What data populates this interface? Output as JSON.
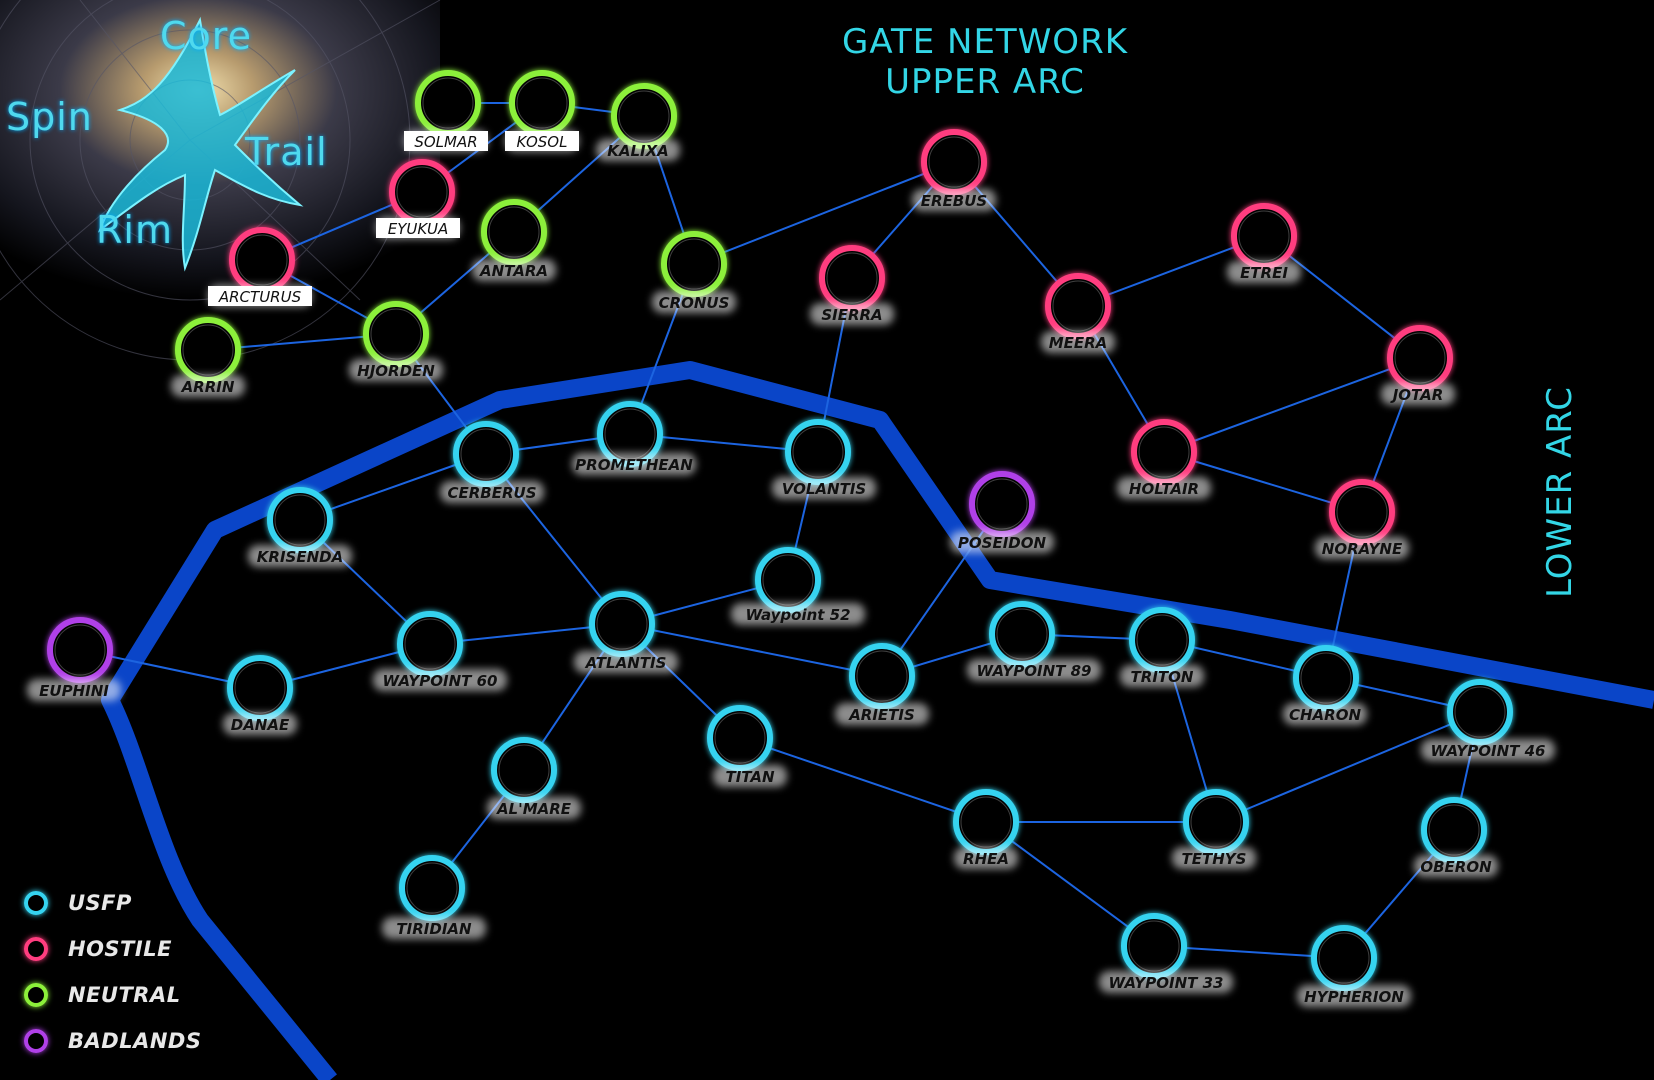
{
  "titles": {
    "upper": "GATE NETWORK\nUPPER ARC",
    "lower": "LOWER ARC"
  },
  "logo": {
    "core": "Core",
    "spin": "Spin",
    "trail": "Trail",
    "rim": "Rim"
  },
  "colors": {
    "USFP": "#35d3f0",
    "HOSTILE": "#ff3d7f",
    "NEUTRAL": "#8cf03a",
    "BADLANDS": "#b040e8",
    "link": "#1c64e0",
    "border": "#0a45c8"
  },
  "legend": [
    {
      "label": "USFP",
      "faction": "USFP"
    },
    {
      "label": "HOSTILE",
      "faction": "HOSTILE"
    },
    {
      "label": "NEUTRAL",
      "faction": "NEUTRAL"
    },
    {
      "label": "BADLANDS",
      "faction": "BADLANDS"
    }
  ],
  "systems": [
    {
      "id": "solmar",
      "name": "SOLMAR",
      "faction": "NEUTRAL"
    },
    {
      "id": "kosol",
      "name": "KOSOL",
      "faction": "NEUTRAL"
    },
    {
      "id": "kalixa",
      "name": "KALIXA",
      "faction": "NEUTRAL"
    },
    {
      "id": "eyukua",
      "name": "EYUKUA",
      "faction": "HOSTILE"
    },
    {
      "id": "antara",
      "name": "ANTARA",
      "faction": "NEUTRAL"
    },
    {
      "id": "arcturus",
      "name": "ARCTURUS",
      "faction": "HOSTILE"
    },
    {
      "id": "arrin",
      "name": "ARRIN",
      "faction": "NEUTRAL"
    },
    {
      "id": "hjorden",
      "name": "HJORDEN",
      "faction": "NEUTRAL"
    },
    {
      "id": "cronus",
      "name": "CRONUS",
      "faction": "NEUTRAL"
    },
    {
      "id": "erebus",
      "name": "EREBUS",
      "faction": "HOSTILE"
    },
    {
      "id": "sierra",
      "name": "SIERRA",
      "faction": "HOSTILE"
    },
    {
      "id": "meera",
      "name": "MEERA",
      "faction": "HOSTILE"
    },
    {
      "id": "etrei",
      "name": "ETREI",
      "faction": "HOSTILE"
    },
    {
      "id": "jotar",
      "name": "JOTAR",
      "faction": "HOSTILE"
    },
    {
      "id": "holtair",
      "name": "HOLTAIR",
      "faction": "HOSTILE"
    },
    {
      "id": "norayne",
      "name": "NORAYNE",
      "faction": "HOSTILE"
    },
    {
      "id": "poseidon",
      "name": "POSEIDON",
      "faction": "BADLANDS"
    },
    {
      "id": "promethean",
      "name": "PROMETHEAN",
      "faction": "USFP"
    },
    {
      "id": "cerberus",
      "name": "CERBERUS",
      "faction": "USFP"
    },
    {
      "id": "volantis",
      "name": "VOLANTIS",
      "faction": "USFP"
    },
    {
      "id": "krisenda",
      "name": "KRISENDA",
      "faction": "USFP"
    },
    {
      "id": "waypoint52",
      "name": "Waypoint 52",
      "faction": "USFP"
    },
    {
      "id": "euphini",
      "name": "EUPHINI",
      "faction": "BADLANDS"
    },
    {
      "id": "waypoint60",
      "name": "WAYPOINT 60",
      "faction": "USFP"
    },
    {
      "id": "atlantis",
      "name": "ATLANTIS",
      "faction": "USFP"
    },
    {
      "id": "danae",
      "name": "DANAE",
      "faction": "USFP"
    },
    {
      "id": "arietis",
      "name": "ARIETIS",
      "faction": "USFP"
    },
    {
      "id": "waypoint89",
      "name": "WAYPOINT 89",
      "faction": "USFP"
    },
    {
      "id": "triton",
      "name": "TRITON",
      "faction": "USFP"
    },
    {
      "id": "charon",
      "name": "CHARON",
      "faction": "USFP"
    },
    {
      "id": "waypoint46",
      "name": "WAYPOINT 46",
      "faction": "USFP"
    },
    {
      "id": "titan",
      "name": "TITAN",
      "faction": "USFP"
    },
    {
      "id": "almare",
      "name": "AL'MARE",
      "faction": "USFP"
    },
    {
      "id": "rhea",
      "name": "RHEA",
      "faction": "USFP"
    },
    {
      "id": "tethys",
      "name": "TETHYS",
      "faction": "USFP"
    },
    {
      "id": "oberon",
      "name": "OBERON",
      "faction": "USFP"
    },
    {
      "id": "tiridian",
      "name": "TIRIDIAN",
      "faction": "USFP"
    },
    {
      "id": "waypoint33",
      "name": "WAYPOINT 33",
      "faction": "USFP"
    },
    {
      "id": "hypherion",
      "name": "HYPHERION",
      "faction": "USFP"
    }
  ],
  "links": [
    [
      "solmar",
      "kosol"
    ],
    [
      "kosol",
      "kalixa"
    ],
    [
      "kosol",
      "eyukua"
    ],
    [
      "eyukua",
      "arcturus"
    ],
    [
      "arcturus",
      "hjorden"
    ],
    [
      "arrin",
      "hjorden"
    ],
    [
      "hjorden",
      "antara"
    ],
    [
      "antara",
      "kalixa"
    ],
    [
      "kalixa",
      "cronus"
    ],
    [
      "cronus",
      "erebus"
    ],
    [
      "erebus",
      "sierra"
    ],
    [
      "erebus",
      "meera"
    ],
    [
      "meera",
      "etrei"
    ],
    [
      "etrei",
      "jotar"
    ],
    [
      "meera",
      "holtair"
    ],
    [
      "holtair",
      "jotar"
    ],
    [
      "holtair",
      "norayne"
    ],
    [
      "jotar",
      "norayne"
    ],
    [
      "norayne",
      "charon"
    ],
    [
      "cronus",
      "promethean"
    ],
    [
      "sierra",
      "volantis"
    ],
    [
      "hjorden",
      "cerberus"
    ],
    [
      "cerberus",
      "promethean"
    ],
    [
      "promethean",
      "volantis"
    ],
    [
      "cerberus",
      "krisenda"
    ],
    [
      "cerberus",
      "atlantis"
    ],
    [
      "volantis",
      "waypoint52"
    ],
    [
      "waypoint52",
      "atlantis"
    ],
    [
      "krisenda",
      "waypoint60"
    ],
    [
      "waypoint60",
      "atlantis"
    ],
    [
      "euphini",
      "danae"
    ],
    [
      "danae",
      "waypoint60"
    ],
    [
      "atlantis",
      "arietis"
    ],
    [
      "atlantis",
      "titan"
    ],
    [
      "atlantis",
      "almare"
    ],
    [
      "poseidon",
      "arietis"
    ],
    [
      "arietis",
      "waypoint89"
    ],
    [
      "waypoint89",
      "triton"
    ],
    [
      "triton",
      "charon"
    ],
    [
      "triton",
      "tethys"
    ],
    [
      "charon",
      "waypoint46"
    ],
    [
      "waypoint46",
      "tethys"
    ],
    [
      "waypoint46",
      "oberon"
    ],
    [
      "titan",
      "rhea"
    ],
    [
      "rhea",
      "tethys"
    ],
    [
      "rhea",
      "waypoint33"
    ],
    [
      "waypoint33",
      "hypherion"
    ],
    [
      "oberon",
      "hypherion"
    ],
    [
      "almare",
      "tiridian"
    ]
  ]
}
